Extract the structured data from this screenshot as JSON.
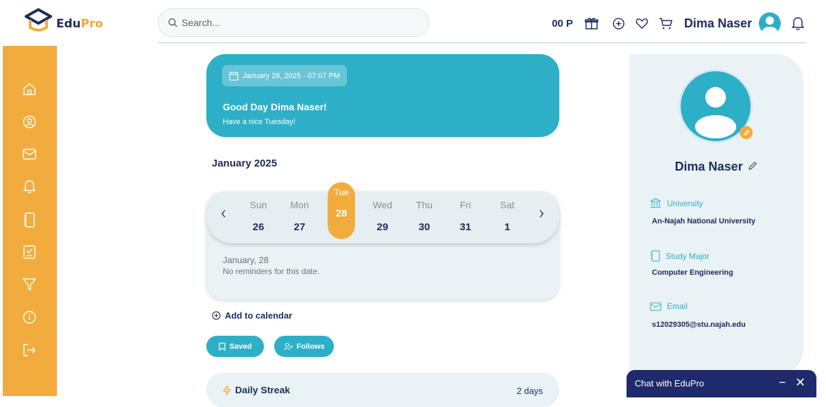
{
  "header": {
    "logo_part1": "Edu",
    "logo_part2": "Pro",
    "search_placeholder": "Search...",
    "points": "00 P",
    "user_name": "Dima Naser"
  },
  "welcome": {
    "date_time": "January 28, 2025 - 07:07 PM",
    "greeting": "Good Day Dima Naser!",
    "subtitle": "Have a nice Tuesday!"
  },
  "calendar": {
    "month": "January 2025",
    "days": [
      {
        "name": "Sun",
        "date": "26"
      },
      {
        "name": "Mon",
        "date": "27"
      },
      {
        "name": "Tue",
        "date": "28"
      },
      {
        "name": "Wed",
        "date": "29"
      },
      {
        "name": "Thu",
        "date": "30"
      },
      {
        "name": "Fri",
        "date": "31"
      },
      {
        "name": "Sat",
        "date": "1"
      }
    ],
    "selected_date": "January, 28",
    "reminder_text": "No reminders for this date.",
    "add_label": "Add to calendar"
  },
  "buttons": {
    "saved": "Saved",
    "follows": "Follows"
  },
  "streak": {
    "title": "Daily Streak",
    "days": "2 days"
  },
  "profile": {
    "name": "Dima Naser",
    "university_label": "University",
    "university_value": "An-Najah National University",
    "major_label": "Study Major",
    "major_value": "Computer Engineering",
    "email_label": "Email",
    "email_value": "s12029305@stu.najah.edu"
  },
  "chat": {
    "title": "Chat with EduPro",
    "minimize": "−",
    "close": "✕"
  },
  "colors": {
    "accent_teal": "#2eafc8",
    "accent_orange": "#f2ac3e",
    "navy": "#1f2b5c"
  }
}
